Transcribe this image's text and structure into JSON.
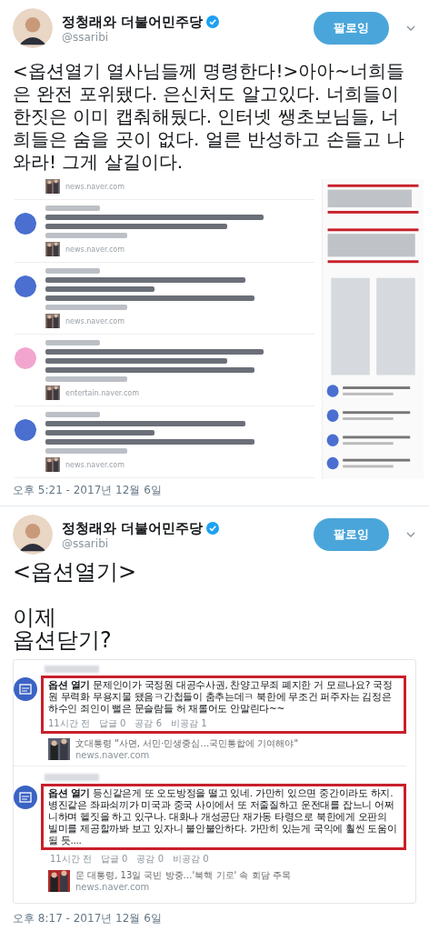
{
  "tweets": [
    {
      "author": {
        "name": "정청래와 더불어민주당",
        "handle": "@ssaribi",
        "verified": true
      },
      "follow_button": "팔로잉",
      "text": "<옵션열기 열사님들께 명령한다!>아아~너희들은 완전 포위됐다. 은신처도 알고있다. 너희들이 한짓은 이미 캡춰해뒀다. 인터넷 쌩초보님들, 너희들은 숨을 곳이 없다. 얼른 반성하고 손들고 나와라! 그게 살길이다.",
      "attachment": {
        "kind": "blurred_comments",
        "comments": [
          {
            "kind": "cut",
            "source": "news.naver.com"
          },
          {
            "kind": "full",
            "color": "#4a6fd0",
            "source": "news.naver.com"
          },
          {
            "kind": "full",
            "color": "#4a6fd0",
            "source": "news.naver.com"
          },
          {
            "kind": "full",
            "color": "#f2a6cf",
            "source": "entertain.naver.com"
          },
          {
            "kind": "full",
            "color": "#4a6fd0",
            "source": "news.naver.com"
          }
        ]
      },
      "timestamp": "오후 5:21 - 2017년 12월 6일"
    },
    {
      "author": {
        "name": "정청래와 더불어민주당",
        "handle": "@ssaribi",
        "verified": true
      },
      "follow_button": "팔로잉",
      "text": "<옵션열기>\n\n이제\n옵션닫기?",
      "attachment": {
        "kind": "comment_card",
        "comments": [
          {
            "label": "옵션 열기",
            "text": "문제인이가 국정원 대공수사권, 찬양고무죄 폐지한 거 모르나요? 국정원 무력화 무용지물 됐음ㅋ간첩들이 춤추는데ㅋ 북한에 무조건 퍼주자는 김정은 하수인 죄인이 뻘은 문슬람들 허 재롤어도 안말린다~~",
            "meta": [
              "11시간 전",
              "답글 0",
              "공감 6",
              "비공감 1"
            ],
            "highlighted": true,
            "link": {
              "title": "文대통령 \"사면, 서민·민생중심…국민통합에 기여해야\"",
              "source": "news.naver.com"
            }
          },
          {
            "label": "옵션 열기",
            "text": "등신같은게 또 오도방정을 떨고 있네. 가만히 있으면 중간이라도 하지. 병진같은 좌파쇠끼가 미국과 중국 사이에서 또 저줄질하고 운전대를 잡느니 어쩌니하며 헬짓을 하고 있구나. 대화나 개성공단 재가동 타령으로 북한에게 오판의 빌미를 제공할까봐 보고 있자니 불안불안하다. 가만히 있는게 국익에 훨씬 도움이 될 듯....",
            "meta": [
              "11시간 전",
              "답글 0",
              "공감 0",
              "비공감 0"
            ],
            "highlighted": true,
            "link": {
              "title": "문 대통령, 13일 국빈 방중…'북핵 기로' 속 회담 주목",
              "source": "news.naver.com"
            }
          }
        ]
      },
      "timestamp": "오후 8:17 - 2017년 12월 6일"
    }
  ]
}
